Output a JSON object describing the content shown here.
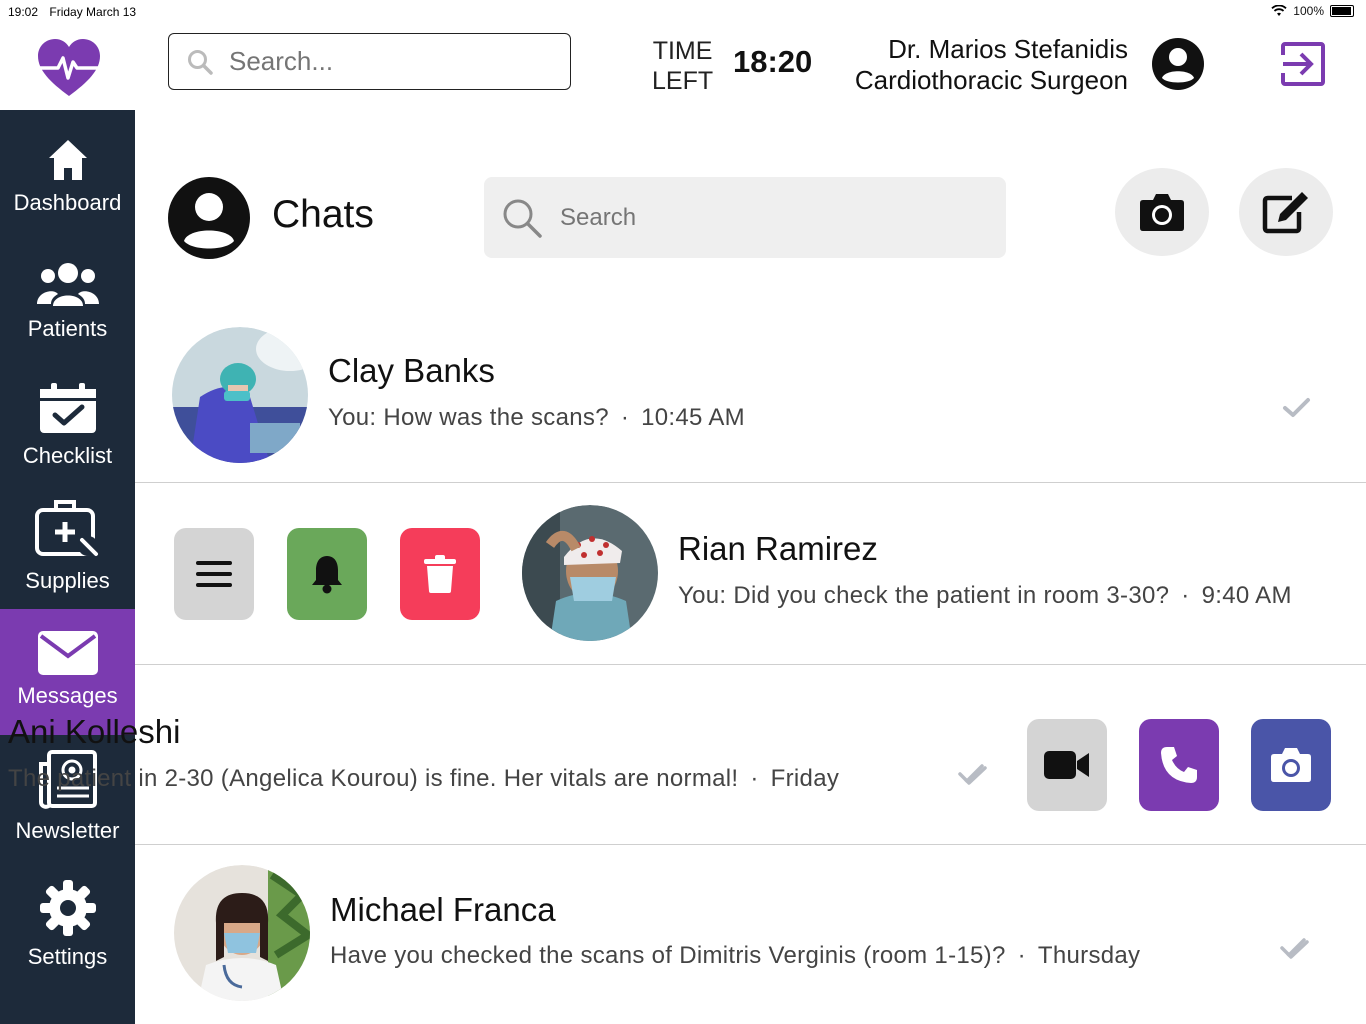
{
  "status_bar": {
    "time": "19:02",
    "date": "Friday March 13",
    "battery": "100%"
  },
  "header": {
    "search_placeholder": "Search...",
    "time_left_label_1": "TIME",
    "time_left_label_2": "LEFT",
    "time_left_value": "18:20",
    "user_name": "Dr. Marios Stefanidis",
    "user_role": "Cardiothoracic Surgeon"
  },
  "sidebar": {
    "items": [
      {
        "label": "Dashboard",
        "icon": "home-icon"
      },
      {
        "label": "Patients",
        "icon": "users-icon"
      },
      {
        "label": "Checklist",
        "icon": "calendar-check-icon"
      },
      {
        "label": "Supplies",
        "icon": "medical-kit-icon"
      },
      {
        "label": "Messages",
        "icon": "envelope-icon",
        "active": true
      },
      {
        "label": "Newsletter",
        "icon": "newspaper-icon"
      },
      {
        "label": "Settings",
        "icon": "gear-icon"
      }
    ]
  },
  "chats": {
    "title": "Chats",
    "search_placeholder": "Search",
    "list": [
      {
        "name": "Clay Banks",
        "message": "You: How was the scans?",
        "time": "10:45 AM"
      },
      {
        "name": "Rian Ramirez",
        "message": "You: Did you check the patient in room 3-30?",
        "time": "9:40 AM"
      },
      {
        "name": "Ani Kolleshi",
        "message": "The patient in 2-30 (Angelica Kourou) is fine. Her vitals are normal!",
        "time": "Friday"
      },
      {
        "name": "Michael Franca",
        "message": "Have you checked the scans of Dimitris Verginis (room 1-15)?",
        "time": "Thursday"
      }
    ]
  },
  "colors": {
    "brand": "#7b3bb0",
    "sidebar_bg": "#1d2a3a",
    "bell_green": "#6aa85a",
    "delete_red": "#f53d5a",
    "call_purple": "#7b3bb0",
    "camera_blue": "#4a55a8"
  }
}
